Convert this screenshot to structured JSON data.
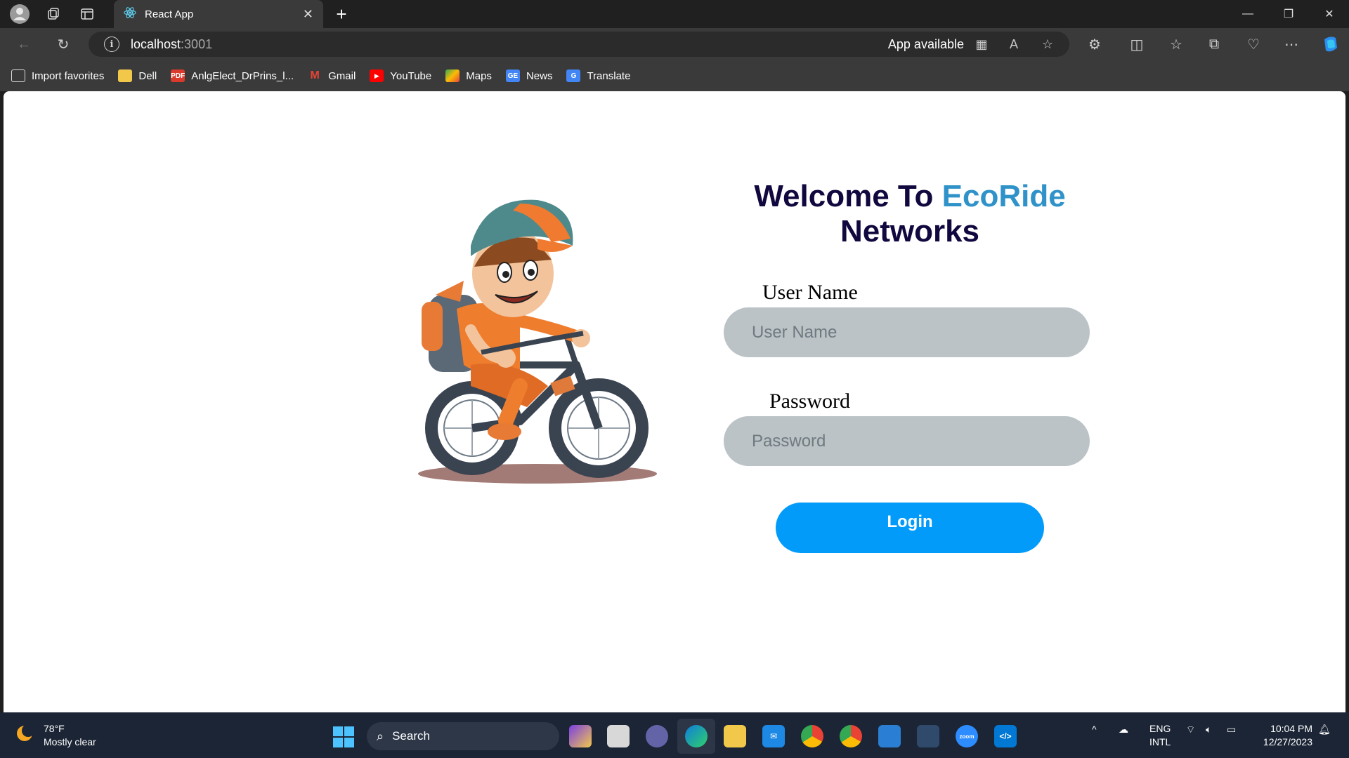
{
  "browser": {
    "tab_title": "React App",
    "url_host": "localhost",
    "url_port": ":3001",
    "app_available": "App available"
  },
  "bookmarks": [
    {
      "label": "Import favorites",
      "icon": "import-icon",
      "color": "#3a3a3a"
    },
    {
      "label": "Dell",
      "icon": "folder-icon",
      "color": "#f2c84b"
    },
    {
      "label": "AnlgElect_DrPrins_l...",
      "icon": "pdf-icon",
      "color": "#d93a2b"
    },
    {
      "label": "Gmail",
      "icon": "gmail-icon",
      "color": "#3a3a3a"
    },
    {
      "label": "YouTube",
      "icon": "youtube-icon",
      "color": "#ff0000"
    },
    {
      "label": "Maps",
      "icon": "maps-icon",
      "color": "#34a853"
    },
    {
      "label": "News",
      "icon": "news-icon",
      "color": "#4285f4"
    },
    {
      "label": "Translate",
      "icon": "translate-icon",
      "color": "#4285f4"
    }
  ],
  "page": {
    "welcome_prefix": "Welcome To ",
    "brand": "EcoRide",
    "welcome_suffix": "Networks",
    "username_label": "User Name",
    "username_placeholder": "User Name",
    "password_label": "Password",
    "password_placeholder": "Password",
    "login_label": "Login",
    "colors": {
      "brand": "#2f92c8",
      "heading": "#10083e",
      "button": "#039bfa",
      "field": "#bbc3c6"
    }
  },
  "taskbar": {
    "weather_temp": "78°F",
    "weather_desc": "Mostly clear",
    "search_label": "Search",
    "lang_1": "ENG",
    "lang_2": "INTL",
    "time": "10:04 PM",
    "date": "12/27/2023"
  }
}
